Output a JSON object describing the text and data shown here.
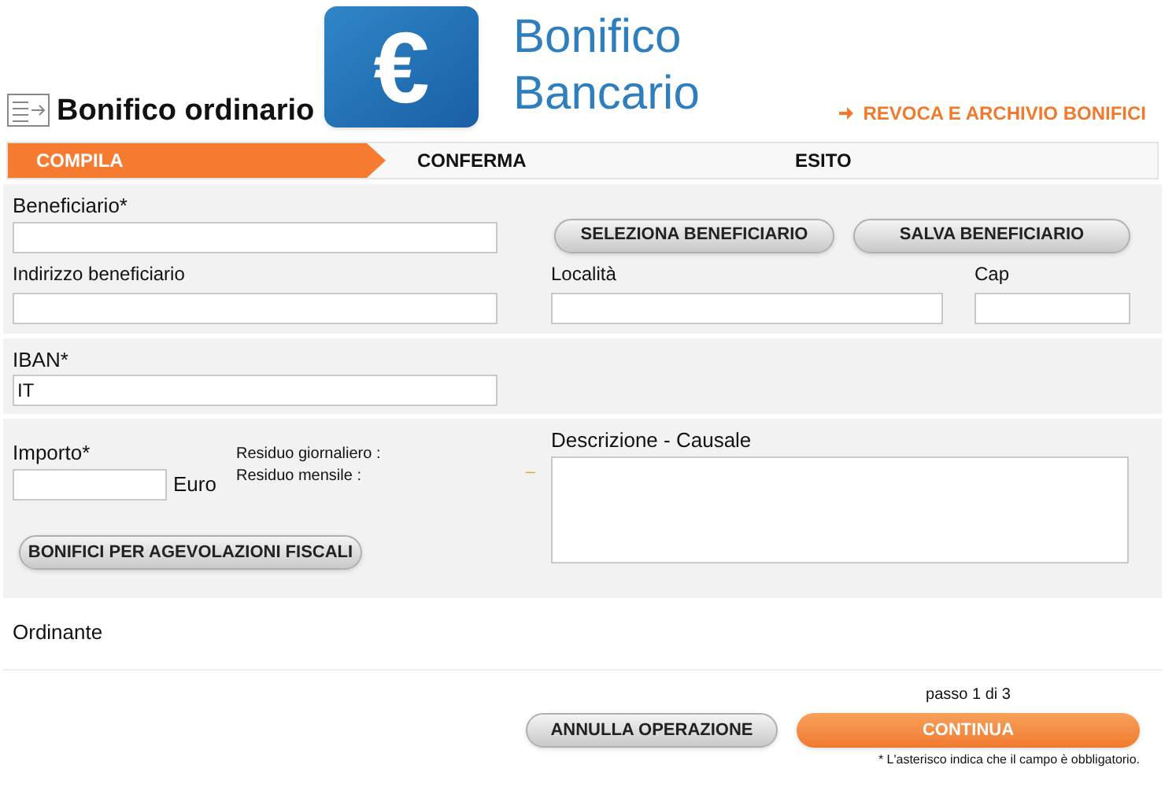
{
  "banner": {
    "title_line1": "Bonifico",
    "title_line2": "Bancario",
    "logo_symbol": "€"
  },
  "page_title": "Bonifico ordinario",
  "archive_link": "REVOCA E ARCHIVIO BONIFICI",
  "steps": [
    {
      "label": "COMPILA",
      "selected": true
    },
    {
      "label": "CONFERMA",
      "selected": false
    },
    {
      "label": "ESITO",
      "selected": false
    }
  ],
  "beneficiary": {
    "label": "Beneficiario*",
    "select_button": "SELEZIONA BENEFICIARIO",
    "save_button": "SALVA BENEFICIARIO",
    "address_label": "Indirizzo beneficiario",
    "city_label": "Località",
    "zip_label": "Cap"
  },
  "iban": {
    "label": "IBAN*",
    "value": "IT"
  },
  "amount": {
    "label": "Importo*",
    "currency": "Euro",
    "daily_residual": "Residuo giornaliero :",
    "monthly_residual": "Residuo mensile :",
    "residual_value": "–",
    "tax_button": "BONIFICI PER AGEVOLAZIONI FISCALI",
    "description_label": "Descrizione - Causale"
  },
  "ordering_label": "Ordinante",
  "footer": {
    "step_counter": "passo 1 di 3",
    "cancel_button": "ANNULLA OPERAZIONE",
    "continue_button": "CONTINUA",
    "note": "* L'asterisco indica che il campo è obbligatorio."
  }
}
